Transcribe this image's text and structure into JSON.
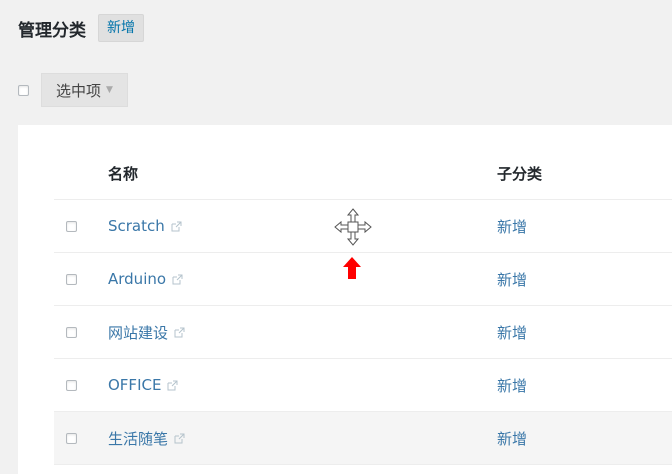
{
  "header": {
    "title": "管理分类",
    "add_new_label": "新增"
  },
  "bulk": {
    "select_label": "选中项",
    "caret": "▼"
  },
  "table": {
    "columns": [
      "名称",
      "子分类"
    ],
    "rows": [
      {
        "name": "Scratch",
        "sub_action": "新增"
      },
      {
        "name": "Arduino",
        "sub_action": "新增"
      },
      {
        "name": "网站建设",
        "sub_action": "新增"
      },
      {
        "name": "OFFICE",
        "sub_action": "新增"
      },
      {
        "name": "生活随笔",
        "sub_action": "新增"
      }
    ],
    "external_icon": "external-link-icon"
  },
  "overlay": {
    "cursor_icon": "move-cursor-icon",
    "marker_icon": "up-arrow-icon",
    "marker_color": "#ff0000"
  },
  "colors": {
    "link": "#3a77a8",
    "background": "#f1f1f1",
    "panel": "#ffffff"
  }
}
